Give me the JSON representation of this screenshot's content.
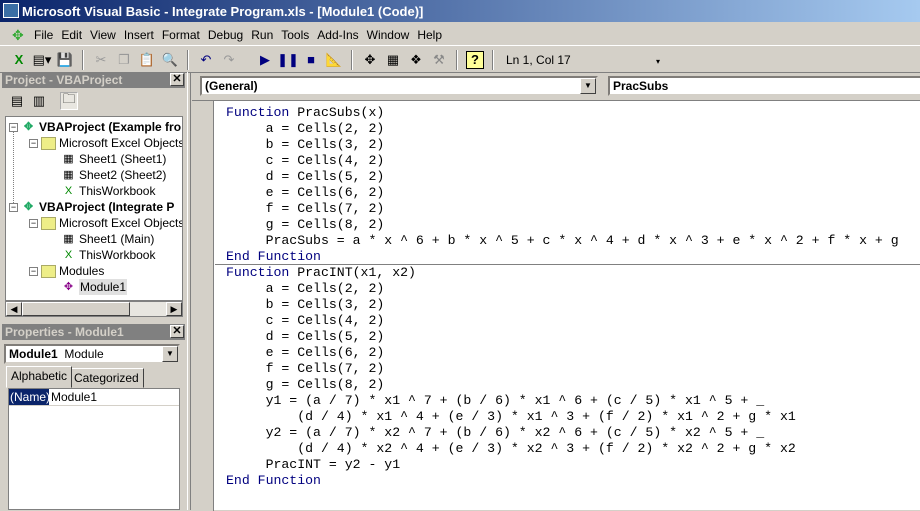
{
  "title": "Microsoft Visual Basic - Integrate Program.xls - [Module1 (Code)]",
  "menu": [
    "File",
    "Edit",
    "View",
    "Insert",
    "Format",
    "Debug",
    "Run",
    "Tools",
    "Add-Ins",
    "Window",
    "Help"
  ],
  "toolbar": {
    "position": "Ln 1, Col 17"
  },
  "project": {
    "title": "Project - VBAProject",
    "tree": [
      "VBAProject (Example fro",
      "Microsoft Excel Objects",
      "Sheet1 (Sheet1)",
      "Sheet2 (Sheet2)",
      "ThisWorkbook",
      "VBAProject (Integrate P",
      "Microsoft Excel Objects",
      "Sheet1 (Main)",
      "ThisWorkbook",
      "Modules",
      "Module1"
    ]
  },
  "properties": {
    "title": "Properties - Module1",
    "object_name": "Module1",
    "object_type": "Module",
    "tabs": [
      "Alphabetic",
      "Categorized"
    ],
    "prop_name": "(Name)",
    "prop_value": "Module1"
  },
  "code": {
    "object_combo": "(General)",
    "proc_combo": "PracSubs",
    "lines": [
      [
        [
          "Function",
          "kw"
        ],
        [
          " PracSubs(x)",
          ""
        ]
      ],
      [
        [
          "     a = Cells(2, 2)",
          ""
        ]
      ],
      [
        [
          "     b = Cells(3, 2)",
          ""
        ]
      ],
      [
        [
          "     c = Cells(4, 2)",
          ""
        ]
      ],
      [
        [
          "     d = Cells(5, 2)",
          ""
        ]
      ],
      [
        [
          "     e = Cells(6, 2)",
          ""
        ]
      ],
      [
        [
          "     f = Cells(7, 2)",
          ""
        ]
      ],
      [
        [
          "     g = Cells(8, 2)",
          ""
        ]
      ],
      [
        [
          "     PracSubs = a * x ^ 6 + b * x ^ 5 + c * x ^ 4 + d * x ^ 3 + e * x ^ 2 + f * x + g",
          ""
        ]
      ],
      [
        [
          "End Function",
          "kw"
        ]
      ],
      [
        [
          "Function",
          "kw"
        ],
        [
          " PracINT(x1, x2)",
          ""
        ]
      ],
      [
        [
          "     a = Cells(2, 2)",
          ""
        ]
      ],
      [
        [
          "     b = Cells(3, 2)",
          ""
        ]
      ],
      [
        [
          "     c = Cells(4, 2)",
          ""
        ]
      ],
      [
        [
          "     d = Cells(5, 2)",
          ""
        ]
      ],
      [
        [
          "     e = Cells(6, 2)",
          ""
        ]
      ],
      [
        [
          "     f = Cells(7, 2)",
          ""
        ]
      ],
      [
        [
          "     g = Cells(8, 2)",
          ""
        ]
      ],
      [
        [
          "     y1 = (a / 7) * x1 ^ 7 + (b / 6) * x1 ^ 6 + (c / 5) * x1 ^ 5 + _",
          ""
        ]
      ],
      [
        [
          "         (d / 4) * x1 ^ 4 + (e / 3) * x1 ^ 3 + (f / 2) * x1 ^ 2 + g * x1",
          ""
        ]
      ],
      [
        [
          "     y2 = (a / 7) * x2 ^ 7 + (b / 6) * x2 ^ 6 + (c / 5) * x2 ^ 5 + _",
          ""
        ]
      ],
      [
        [
          "         (d / 4) * x2 ^ 4 + (e / 3) * x2 ^ 3 + (f / 2) * x2 ^ 2 + g * x2",
          ""
        ]
      ],
      [
        [
          "     PracINT = y2 - y1",
          ""
        ]
      ],
      [
        [
          "End Function",
          "kw"
        ]
      ]
    ]
  }
}
